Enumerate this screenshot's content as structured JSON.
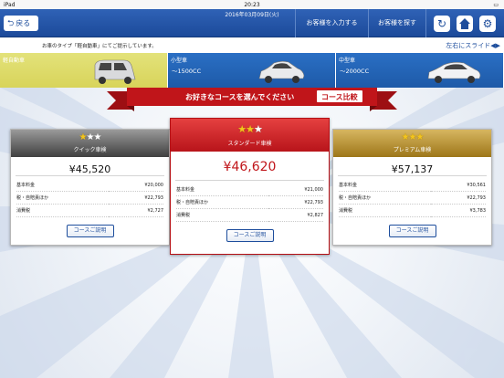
{
  "status": {
    "carrier": "iPad",
    "time": "20:23",
    "battery": "━"
  },
  "nav": {
    "back_label": "戻る",
    "date": "2016年03月09日(火)",
    "input_customer": "お客様を入力する",
    "find_customer": "お客様を探す",
    "icons": {
      "reload": "reload-icon",
      "home": "home-icon",
      "settings": "gear-icon"
    }
  },
  "info": {
    "car_type_text": "お車のタイプ「軽自動車」にてご提示しています。",
    "slide_hint": "左右にスライド◀▶"
  },
  "cars": [
    {
      "label": "軽自動車",
      "sub": "",
      "selected": true
    },
    {
      "label": "小型車",
      "sub": "～1500CC",
      "selected": false
    },
    {
      "label": "中型車",
      "sub": "～2000CC",
      "selected": false
    }
  ],
  "banner": {
    "text": "お好きなコースを選んでください",
    "compare_button": "コース比較",
    "color": "#c0151a"
  },
  "courses": [
    {
      "name": "クイック車検",
      "stars": 1,
      "price": "¥45,520",
      "rows": [
        {
          "label": "基本料金",
          "value": "¥20,000"
        },
        {
          "label": "税・自賠責ほか",
          "value": "¥22,793"
        },
        {
          "label": "消費税",
          "value": "¥2,727"
        }
      ],
      "detail_button": "コースご説明"
    },
    {
      "name": "スタンダード車検",
      "stars": 2,
      "price": "¥46,620",
      "rows": [
        {
          "label": "基本料金",
          "value": "¥21,000"
        },
        {
          "label": "税・自賠責ほか",
          "value": "¥22,793"
        },
        {
          "label": "消費税",
          "value": "¥2,827"
        }
      ],
      "detail_button": "コースご説明"
    },
    {
      "name": "プレミアム車検",
      "stars": 3,
      "price": "¥57,137",
      "rows": [
        {
          "label": "基本料金",
          "value": "¥30,561"
        },
        {
          "label": "税・自賠責ほか",
          "value": "¥22,793"
        },
        {
          "label": "消費税",
          "value": "¥3,783"
        }
      ],
      "detail_button": "コースご説明"
    }
  ]
}
